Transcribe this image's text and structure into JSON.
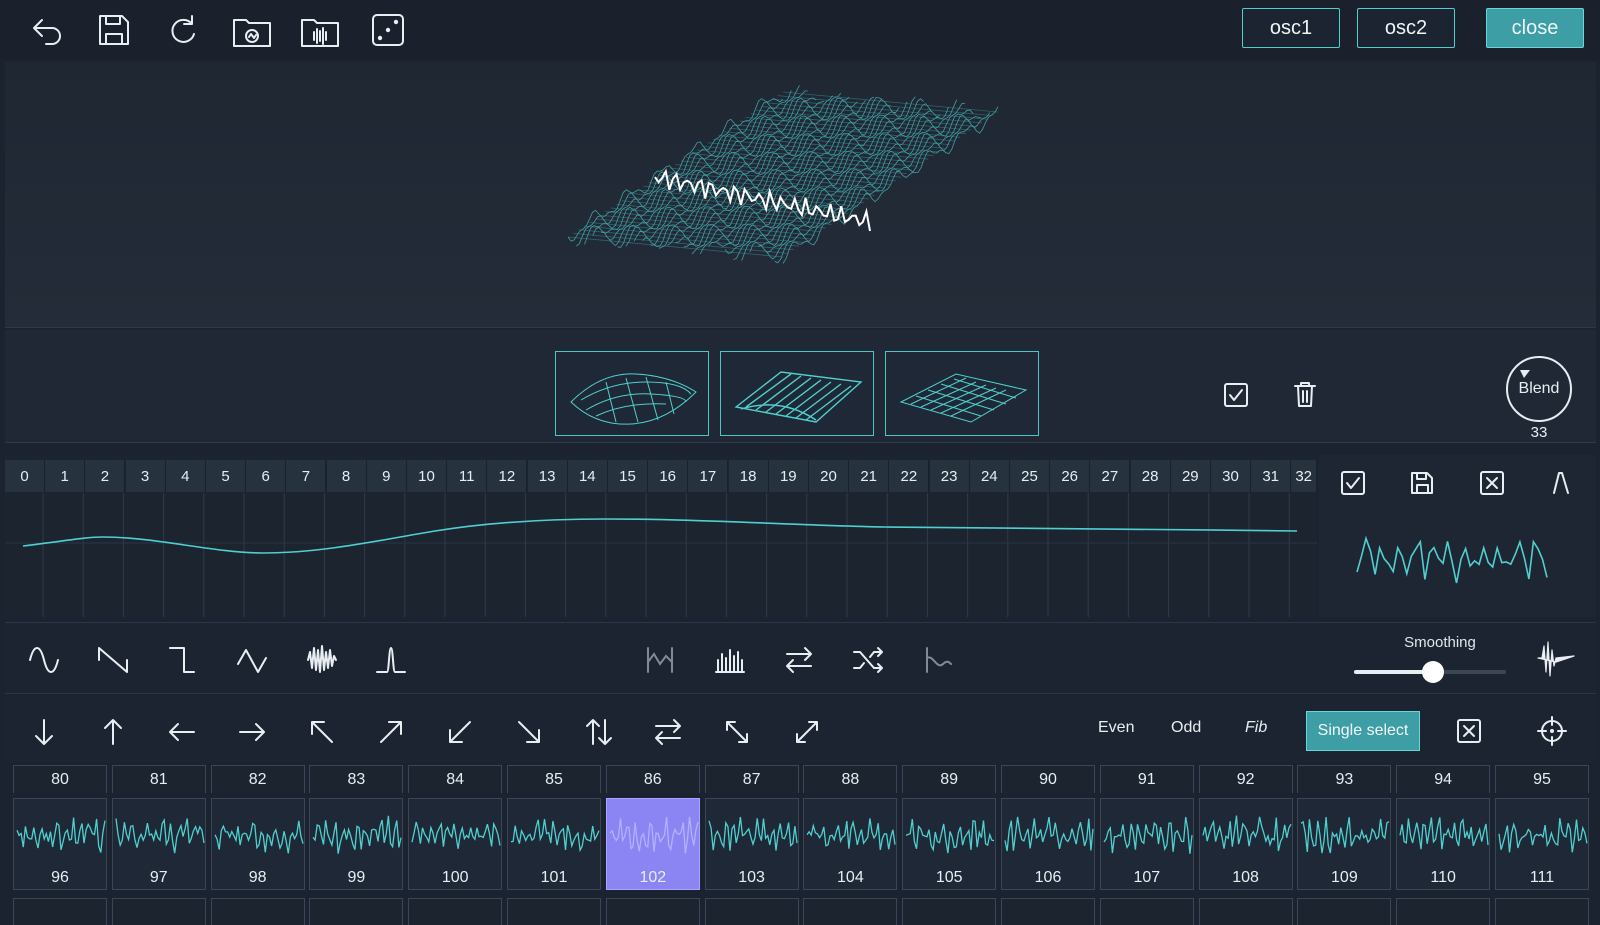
{
  "topbar": {
    "icons": [
      "undo-icon",
      "save-icon",
      "redo-icon",
      "open-folder-icon",
      "sample-folder-icon",
      "random-dice-icon"
    ],
    "osc1_label": "osc1",
    "osc2_label": "osc2",
    "close_label": "close"
  },
  "blend": {
    "label": "Blend",
    "value": "33"
  },
  "timeline": {
    "numbers": [
      "0",
      "1",
      "2",
      "3",
      "4",
      "5",
      "6",
      "7",
      "8",
      "9",
      "10",
      "11",
      "12",
      "13",
      "14",
      "15",
      "16",
      "17",
      "18",
      "19",
      "20",
      "21",
      "22",
      "23",
      "24",
      "25",
      "26",
      "27",
      "28",
      "29",
      "30",
      "31",
      "32"
    ]
  },
  "tools": {
    "smoothing_label": "Smoothing",
    "smoothing_value": 0.52
  },
  "arrowrow": {
    "even_label": "Even",
    "odd_label": "Odd",
    "fib_label": "Fib",
    "single_select_label": "Single select"
  },
  "grid": {
    "top_numbers": [
      "80",
      "81",
      "82",
      "83",
      "84",
      "85",
      "86",
      "87",
      "88",
      "89",
      "90",
      "91",
      "92",
      "93",
      "94",
      "95"
    ],
    "cell_numbers": [
      "96",
      "97",
      "98",
      "99",
      "100",
      "101",
      "102",
      "103",
      "104",
      "105",
      "106",
      "107",
      "108",
      "109",
      "110",
      "111"
    ],
    "selected": "102"
  },
  "colors": {
    "accent": "#4fd0cf",
    "selected": "#8a85f2",
    "background": "#1c2330"
  }
}
